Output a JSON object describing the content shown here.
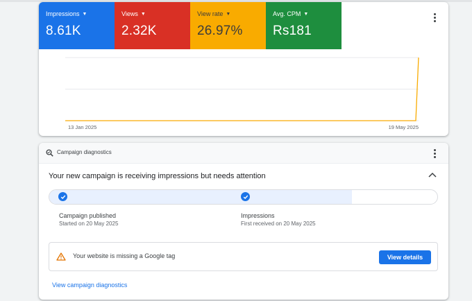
{
  "metrics": [
    {
      "label": "Impressions",
      "value": "8.61K",
      "color": "#1a73e8",
      "text_color": "#ffffff"
    },
    {
      "label": "Views",
      "value": "2.32K",
      "color": "#d93025",
      "text_color": "#ffffff"
    },
    {
      "label": "View rate",
      "value": "26.97%",
      "color": "#f9ab00",
      "text_color": "#3c3c3c"
    },
    {
      "label": "Avg. CPM",
      "value": "Rs181",
      "color": "#1e8e3e",
      "text_color": "#ffffff"
    }
  ],
  "chart_data": {
    "type": "line",
    "x_tick_labels": [
      "13 Jan 2025",
      "19 May 2025"
    ],
    "series": [
      {
        "color": "#f9ab00",
        "points": [
          {
            "x": "2025-01-13",
            "y": 0
          },
          {
            "x": "2025-05-19",
            "y": 0
          },
          {
            "x": "2025-05-20",
            "y": 1
          }
        ]
      }
    ],
    "grid": true,
    "gridlines": 3,
    "y_axis_labels": "none"
  },
  "diagnostics": {
    "header_title": "Campaign diagnostics",
    "headline": "Your new campaign is receiving impressions but needs attention",
    "progress_fraction": 0.78,
    "steps": [
      {
        "title": "Campaign published",
        "subtitle": "Started on 20 May 2025"
      },
      {
        "title": "Impressions",
        "subtitle": "First received on 20 May 2025"
      }
    ],
    "alert": {
      "text": "Your website is missing a Google tag",
      "button": "View details"
    },
    "link": "View campaign diagnostics"
  },
  "icons": {
    "metric_caret": "caret-down-icon",
    "more": "more-vert-icon",
    "diagnostics": "search-diagnostics-icon",
    "collapse": "chevron-up-icon",
    "check": "check-icon",
    "warning": "warning-icon"
  },
  "colors": {
    "accent": "#1a73e8",
    "warning": "#e37400",
    "line": "#f9ab00"
  }
}
